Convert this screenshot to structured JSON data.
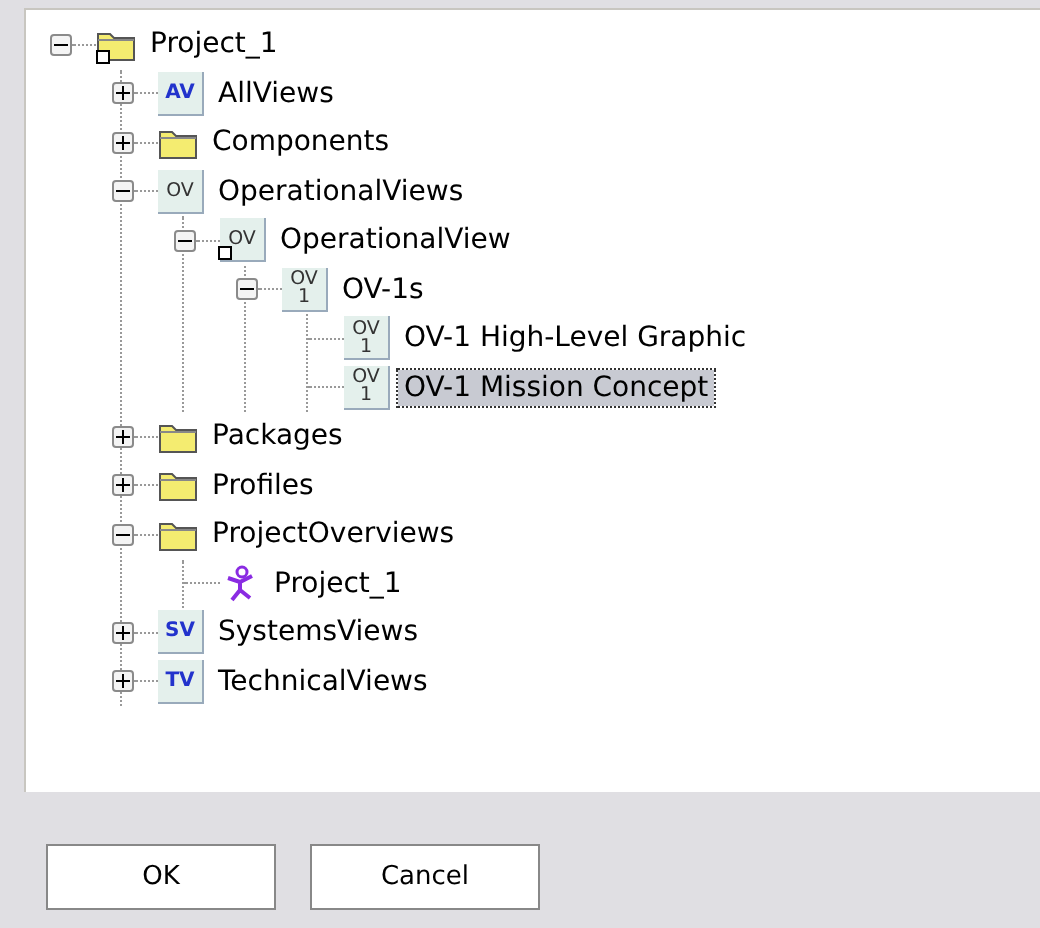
{
  "tree": [
    {
      "label": "Project_1",
      "kind": "shortcut",
      "expanded": true,
      "selected": false,
      "children": [
        {
          "label": "AllViews",
          "kind": "view",
          "icon_text": [
            "AV"
          ],
          "expanded": false,
          "selected": false
        },
        {
          "label": "Components",
          "kind": "folder",
          "expanded": false,
          "selected": false
        },
        {
          "label": "OperationalViews",
          "kind": "overview",
          "icon_text": [
            "OV"
          ],
          "expanded": true,
          "selected": false,
          "children": [
            {
              "label": "OperationalView",
              "kind": "viewlink",
              "icon_text": [
                "OV"
              ],
              "expanded": true,
              "selected": false,
              "children": [
                {
                  "label": "OV-1s",
                  "kind": "overview",
                  "icon_text": [
                    "OV",
                    "1"
                  ],
                  "expanded": true,
                  "selected": false,
                  "children": [
                    {
                      "label": "OV-1 High-Level Graphic",
                      "kind": "overview",
                      "icon_text": [
                        "OV",
                        "1"
                      ],
                      "selected": false
                    },
                    {
                      "label": "OV-1 Mission Concept",
                      "kind": "overview",
                      "icon_text": [
                        "OV",
                        "1"
                      ],
                      "selected": true
                    }
                  ]
                }
              ]
            }
          ]
        },
        {
          "label": "Packages",
          "kind": "folder",
          "expanded": false,
          "selected": false
        },
        {
          "label": "Profiles",
          "kind": "folder",
          "expanded": false,
          "selected": false
        },
        {
          "label": "ProjectOverviews",
          "kind": "folder",
          "expanded": true,
          "selected": false,
          "children": [
            {
              "label": "Project_1",
              "kind": "figure",
              "selected": false
            }
          ]
        },
        {
          "label": "SystemsViews",
          "kind": "view",
          "icon_text": [
            "SV"
          ],
          "expanded": false,
          "selected": false
        },
        {
          "label": "TechnicalViews",
          "kind": "view",
          "icon_text": [
            "TV"
          ],
          "expanded": false,
          "selected": false
        }
      ]
    }
  ],
  "buttons": [
    "OK",
    "Cancel"
  ]
}
